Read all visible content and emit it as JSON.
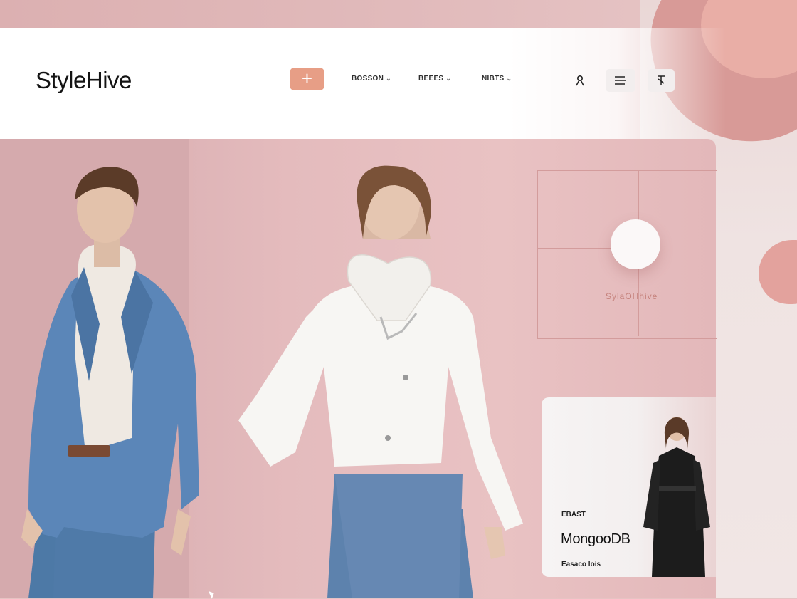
{
  "brand": {
    "name": "StyleHive"
  },
  "header": {
    "add_label": "+",
    "nav": [
      {
        "label": "BOSSON"
      },
      {
        "label": "BEEES"
      },
      {
        "label": "NIBTS"
      }
    ],
    "icons": [
      "user-icon",
      "menu-icon",
      "share-icon"
    ]
  },
  "hero": {
    "wall_sign": "SylaOHhive",
    "models": [
      "blue-blazer-model",
      "white-jacket-model"
    ]
  },
  "card": {
    "tag": "EBAST",
    "title": "MongooDB",
    "subtitle": "Easaco lois"
  },
  "colors": {
    "accent": "#e79e86",
    "hero_pink": "#e4bbbd",
    "blob": "#d89a97"
  }
}
